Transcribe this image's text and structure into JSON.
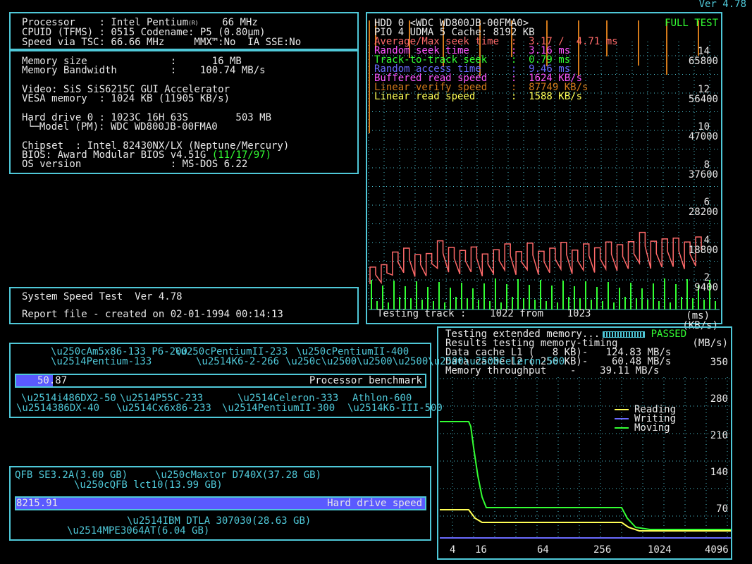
{
  "version": "Ver 4.78",
  "sysinfo": {
    "processor": "Processor    : Intel Pentium",
    "processor_mark": "(R)",
    "processor_speed": "66 MHz",
    "cpuid": "CPUID (TFMS) : 0515 Codename: P5 (0.80µm)",
    "tsc": "Speed via TSC: 66.66 MHz     MMX™:No  IA SSE:No",
    "mem_size": "Memory size              :      16 MB",
    "mem_bw": "Memory Bandwidth         :    100.74 MB/s",
    "video": "Video: SiS SiS6215C GUI Accelerator",
    "vesa": "VESA memory  : 1024 KB (11905 KB/s)",
    "hdd": "Hard drive 0 : 1023C 16H 63S        503 MB",
    "hdd_model": "└─Model (PM): WDC WD800JB-00FMA0",
    "chipset": "Chipset  : Intel 82430NX/LX (Neptune/Mercury)",
    "bios": "BIOS: Award Modular BIOS v4.51G",
    "bios_date": "(11/17/97)",
    "os": "OS version               : MS-DOS 6.22"
  },
  "speedtest": {
    "title": "System Speed Test  Ver 4.78",
    "report": "Report file - created on 02-01-1994 00:14:13"
  },
  "hdd_test": {
    "header1": "HDD 0 <WDC WD800JB-00FMA0>",
    "full_test": "FULL TEST",
    "header2": "PIO 4 UDMA 5 Cache: 8192 KB",
    "rows": [
      {
        "label": "Average/Max seek time  :",
        "value": "3.17 /  4.71 ms",
        "color": "#ff6a6a"
      },
      {
        "label": "Random seek time       :",
        "value": "3.16 ms",
        "color": "#ff55ff"
      },
      {
        "label": "Track-to-track seek    :",
        "value": "0.79 ms",
        "color": "#33ff33"
      },
      {
        "label": "Random access time     :",
        "value": "9.46 ms",
        "color": "#6a6aff"
      },
      {
        "label": "Buffered read speed    :",
        "value": "1624 KB/s",
        "color": "#ff55ff"
      },
      {
        "label": "Linear verify speed    :",
        "value": "87749 KB/s",
        "color": "#d47a1a"
      },
      {
        "label": "Linear read speed      :",
        "value": "1588 KB/s",
        "color": "#ffff55"
      }
    ],
    "ms_labels": [
      "14",
      "12",
      "10",
      "8",
      "6",
      "4",
      "2",
      "(ms)"
    ],
    "kb_labels": [
      "65800",
      "56400",
      "47000",
      "37600",
      "28200",
      "18800",
      "9400",
      "(KB/s)"
    ],
    "status": "Testing track :    1022 from    1023",
    "read_speed_values": [
      11000,
      11600,
      14900,
      15900,
      14200,
      14500,
      17800,
      16100,
      15300,
      16200,
      14400,
      15500,
      17000,
      15000,
      17200,
      15100,
      15900,
      17400,
      15400,
      17000,
      16000,
      17500,
      16800,
      17600,
      20000,
      17700,
      18300,
      18500,
      17500,
      18800
    ]
  },
  "memtest": {
    "line1": "Testing extended memory...",
    "passed": "PASSED",
    "line2": "Results testing memory-timing",
    "unit": "(MB/s)",
    "l1": "Data cache L1 (   8 KB)-   124.83 MB/s",
    "l2": "Data cache L2 ( 256 KB)-    60.48 MB/s",
    "throughput": "Memory throughput    -    39.11 MB/s",
    "legend": [
      {
        "label": "Reading",
        "color": "#ffff55"
      },
      {
        "label": "Writing",
        "color": "#6a6aff"
      },
      {
        "label": "Moving",
        "color": "#33ff33"
      }
    ],
    "y_labels": [
      "350",
      "280",
      "210",
      "140",
      "70"
    ],
    "x_labels": [
      "4",
      "16",
      "64",
      "256",
      "1024",
      "4096"
    ]
  },
  "cpu_bench": {
    "value": "50.87",
    "fill_fraction": 0.09,
    "label": "Processor benchmark",
    "top_refs": [
      "Am5x86-133",
      "P6-200",
      "PentiumII-233",
      "PentiumII-400",
      "Pentium-133",
      "K6-2-266",
      "Celeron-500"
    ],
    "bottom_refs": [
      "i486DX2-50",
      "P55C-233",
      "Celeron-333",
      "Athlon-600",
      "386DX-40",
      "Cx6x86-233",
      "PentiumII-300",
      "K6-III-500"
    ]
  },
  "hdd_bench": {
    "value": "8215.91",
    "fill_fraction": 1.0,
    "label": "Hard drive speed",
    "top_refs": [
      "QFB SE3.2A(3.00 GB)",
      "Maxtor D740X(37.28 GB)",
      "QFB lct10(13.99 GB)"
    ],
    "bottom_refs": [
      "IBM DTLA 307030(28.63 GB)",
      "MPE3064AT(6.04 GB)"
    ]
  }
}
